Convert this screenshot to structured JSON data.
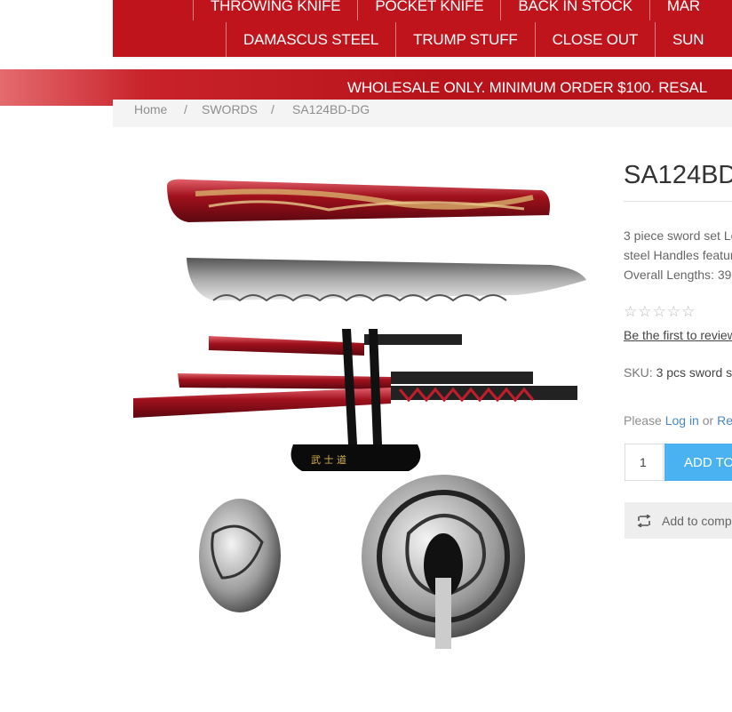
{
  "nav": {
    "row1": [
      "THROWING KNIFE",
      "POCKET KNIFE",
      "BACK IN STOCK",
      "MAR"
    ],
    "row2": [
      "DAMASCUS STEEL",
      "TRUMP STUFF",
      "CLOSE OUT",
      "SUN"
    ]
  },
  "banner": {
    "text": "WHOLESALE ONLY. MINIMUM ORDER $100. RESAL"
  },
  "breadcrumb": {
    "home": "Home",
    "sep": "/",
    "category": "SWORDS",
    "current": "SA124BD-DG"
  },
  "product": {
    "title": "SA124BD",
    "description_lines": [
      "3 piece sword set Lo",
      "steel Handles featur",
      "Overall Lengths: 39"
    ],
    "stars_text": "☆☆☆☆☆",
    "review_link": "Be the first to review",
    "sku_label": "SKU:",
    "sku_value": "3 pcs sword s",
    "login_prefix": "Please",
    "login_link": "Log in",
    "login_or": "or",
    "register_link": "Re",
    "quantity": "1",
    "add_to_cart": "ADD TO",
    "compare": "Add to compa"
  },
  "colors": {
    "nav_red": "#c0141c",
    "banner_red": "#b8131b",
    "cart_blue": "#4ab2f1",
    "link_blue": "#4a86c5"
  }
}
